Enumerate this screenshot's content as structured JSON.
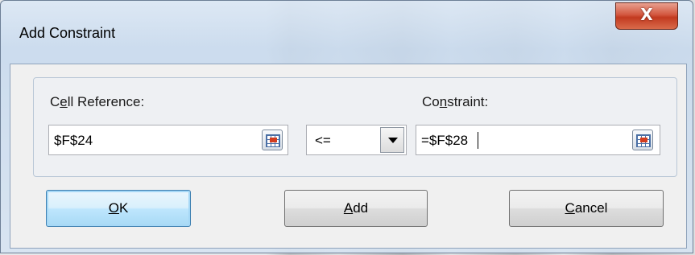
{
  "dialog": {
    "title": "Add Constraint",
    "close_label": "X"
  },
  "cell_reference": {
    "label_pre": "C",
    "label_accel": "e",
    "label_post": "ll Reference:",
    "value": "$F$24"
  },
  "operator": {
    "value": "<="
  },
  "constraint": {
    "label_pre": "Co",
    "label_accel": "n",
    "label_post": "straint:",
    "value": "=$F$28"
  },
  "buttons": {
    "ok_accel": "O",
    "ok_post": "K",
    "add_accel": "A",
    "add_post": "dd",
    "cancel_accel": "C",
    "cancel_post": "ancel"
  },
  "colors": {
    "default_button_border": "#3c7fb1",
    "close_button": "#c23a20"
  },
  "icons": [
    "close-icon",
    "collapse-dialog-icon",
    "chevron-down-icon"
  ]
}
